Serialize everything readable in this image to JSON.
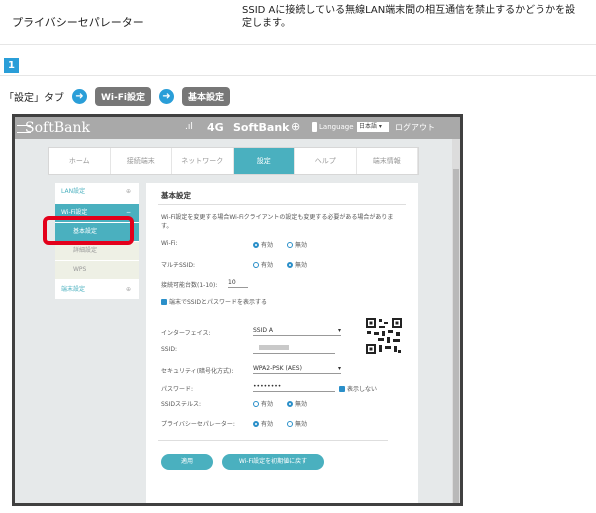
{
  "doc": {
    "setting_name": "プライバシーセパレーター",
    "setting_desc": "SSID Aに接続している無線LAN端末間の相互通信を禁止するかどうかを設定します。",
    "step_number": "1",
    "path_prefix": "「設定」タブ",
    "path_chip1": "Wi-Fi設定",
    "path_chip2": "基本設定"
  },
  "device": {
    "logo": "SoftBank",
    "signal": ".ıl",
    "network": "4G",
    "carrier": "SoftBank",
    "language_label": "Language",
    "language_value": "日本語",
    "logout": "ログアウト"
  },
  "tabs": [
    {
      "label": "ホーム"
    },
    {
      "label": "接続端末"
    },
    {
      "label": "ネットワーク"
    },
    {
      "label": "設定"
    },
    {
      "label": "ヘルプ"
    },
    {
      "label": "端末情報"
    }
  ],
  "sidebar": {
    "lan": "LAN設定",
    "wifi": "Wi-Fi設定",
    "basic": "基本設定",
    "detail": "詳細設定",
    "wps": "WPS",
    "device": "端末設定"
  },
  "panel": {
    "title": "基本設定",
    "desc": "Wi-Fi設定を変更する場合Wi-Fiクライアントの設定も変更する必要がある場合があります。",
    "wifi_label": "Wi-Fi:",
    "multi_ssid_label": "マルチSSID:",
    "max_conn_label": "接続可能台数(1-10):",
    "max_conn_value": "10",
    "show_ssid_pw": "端末でSSIDとパスワードを表示する",
    "interface_label": "インターフェイス:",
    "interface_value": "SSID A",
    "ssid_label": "SSID:",
    "ssid_value": "",
    "security_label": "セキュリティ(暗号化方式):",
    "security_value": "WPA2-PSK (AES)",
    "password_label": "パスワード:",
    "password_value": "••••••••",
    "hide_label": "表示しない",
    "stealth_label": "SSIDステルス:",
    "privacy_label": "プライバシーセパレーター:",
    "on": "有効",
    "off": "無効",
    "apply_button": "適用",
    "reset_button": "Wi-Fi設定を初期値に戻す"
  }
}
